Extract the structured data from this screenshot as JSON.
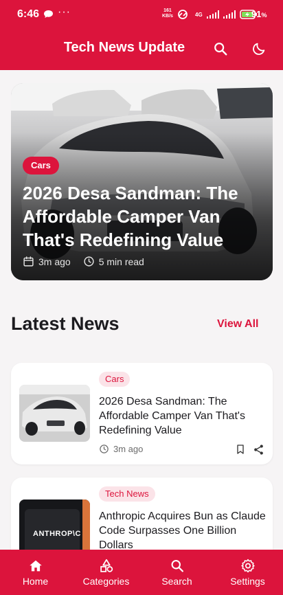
{
  "status_bar": {
    "time": "6:46",
    "more": "···",
    "speed_value": "161",
    "speed_unit": "KB/s",
    "network": "4G",
    "battery_percent": "91",
    "battery_suffix": "%"
  },
  "app_bar": {
    "title": "Tech News Update",
    "icons": [
      "search-icon",
      "dark-mode-icon"
    ]
  },
  "featured": {
    "category": "Cars",
    "title": "2026 Desa Sandman: The Affordable Camper Van That's Redefining Value",
    "time_ago": "3m ago",
    "read_time": "5 min read"
  },
  "latest": {
    "heading": "Latest News",
    "view_all": "View All",
    "items": [
      {
        "category": "Cars",
        "title": "2026 Desa Sandman: The Affordable Camper Van That's Redefining Value",
        "time_ago": "3m ago"
      },
      {
        "category": "Tech News",
        "title": "Anthropic Acquires Bun as Claude Code Surpasses One Billion Dollars",
        "thumb_text": "ANTHROP\\C"
      }
    ]
  },
  "bottom_nav": {
    "items": [
      {
        "label": "Home",
        "icon": "home-icon"
      },
      {
        "label": "Categories",
        "icon": "categories-icon"
      },
      {
        "label": "Search",
        "icon": "search-icon"
      },
      {
        "label": "Settings",
        "icon": "settings-icon"
      }
    ]
  },
  "colors": {
    "primary": "#dc143c",
    "chip_background": "#fbe3e8",
    "background": "#f6f4f5"
  }
}
